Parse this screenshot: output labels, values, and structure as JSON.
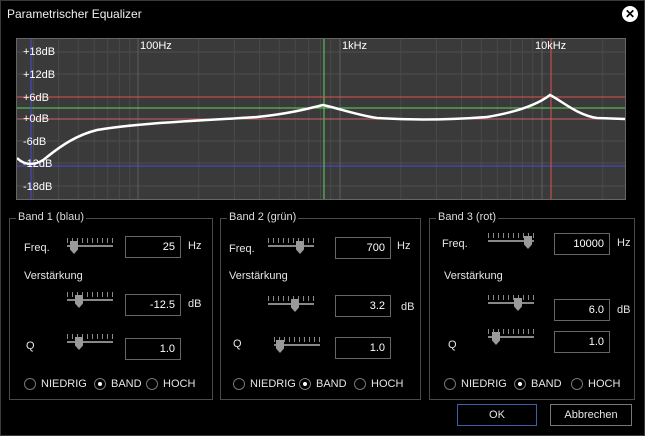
{
  "window": {
    "title": "Parametrischer Equalizer",
    "close_icon": "close-icon"
  },
  "graph": {
    "db_labels": [
      "+18dB",
      "+12dB",
      "+6dB",
      "+0dB",
      "-6dB",
      "-12dB",
      "-18dB"
    ],
    "freq_labels": [
      "100Hz",
      "1kHz",
      "10kHz"
    ],
    "colors": {
      "band1": "#4a4ad8",
      "band2": "#5fd65f",
      "band3": "#e05050",
      "curve": "#ffffff"
    }
  },
  "band1": {
    "title": "Band 1 (blau)",
    "freq_label": "Freq.",
    "freq_value": "25",
    "freq_unit": "Hz",
    "gain_label": "Verstärkung",
    "gain_value": "-12.5",
    "gain_unit": "dB",
    "q_label": "Q",
    "q_value": "1.0",
    "modes": [
      "NIEDRIG",
      "BAND",
      "HOCH"
    ],
    "selected_mode": "BAND"
  },
  "band2": {
    "title": "Band 2 (grün)",
    "freq_label": "Freq.",
    "freq_value": "700",
    "freq_unit": "Hz",
    "gain_label": "Verstärkung",
    "gain_value": "3.2",
    "gain_unit": "dB",
    "q_label": "Q",
    "q_value": "1.0",
    "modes": [
      "NIEDRIG",
      "BAND",
      "HOCH"
    ],
    "selected_mode": "BAND"
  },
  "band3": {
    "title": "Band 3 (rot)",
    "freq_label": "Freq.",
    "freq_value": "10000",
    "freq_unit": "Hz",
    "gain_label": "Verstärkung",
    "gain_value": "6.0",
    "gain_unit": "dB",
    "q_label": "Q",
    "q_value": "1.0",
    "modes": [
      "NIEDRIG",
      "BAND",
      "HOCH"
    ],
    "selected_mode": "BAND"
  },
  "buttons": {
    "ok": "OK",
    "cancel": "Abbrechen"
  }
}
